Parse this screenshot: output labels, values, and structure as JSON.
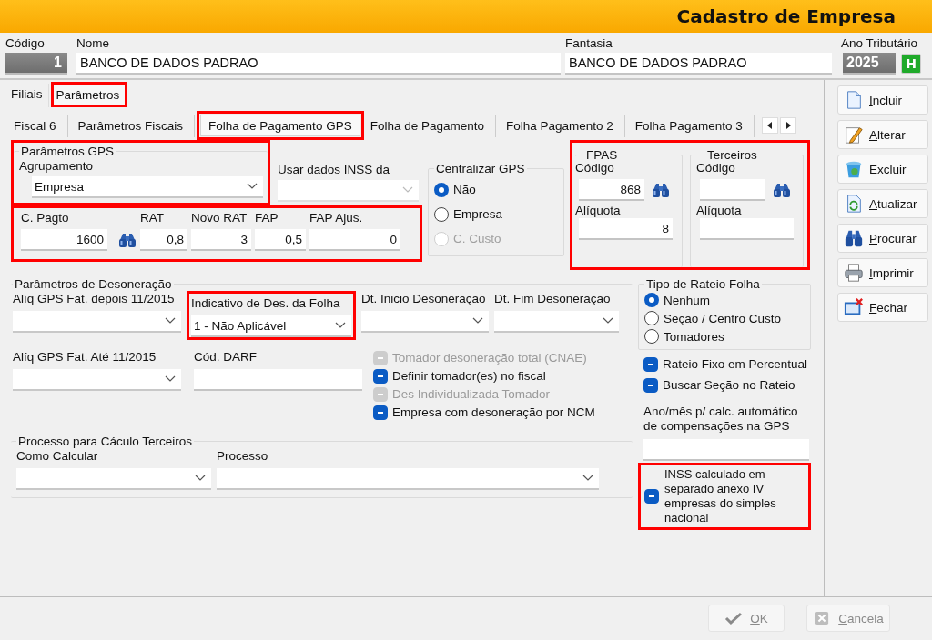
{
  "window": {
    "title": "Cadastro de Empresa"
  },
  "header": {
    "codigo": {
      "label": "Código",
      "value": "1"
    },
    "nome": {
      "label": "Nome",
      "value": "BANCO DE DADOS PADRAO"
    },
    "fantasia": {
      "label": "Fantasia",
      "value": "BANCO DE DADOS PADRAO"
    },
    "ano": {
      "label": "Ano Tributário",
      "value": "2025",
      "button": "H"
    }
  },
  "outer_tabs": [
    {
      "label": "Filiais",
      "selected": false,
      "highlighted": false
    },
    {
      "label": "Parâmetros",
      "selected": true,
      "highlighted": true
    }
  ],
  "inner_tabs": [
    {
      "label": "Fiscal 6",
      "selected": false,
      "highlighted": false
    },
    {
      "label": "Parâmetros Fiscais",
      "selected": false,
      "highlighted": false
    },
    {
      "label": "Folha de Pagamento GPS",
      "selected": true,
      "highlighted": true
    },
    {
      "label": "Folha de Pagamento",
      "selected": false,
      "highlighted": false
    },
    {
      "label": "Folha Pagamento 2",
      "selected": false,
      "highlighted": false
    },
    {
      "label": "Folha Pagamento 3",
      "selected": false,
      "highlighted": false
    }
  ],
  "parametros_gps": {
    "highlighted": true,
    "title": "Parâmetros GPS",
    "label": "Agrupamento",
    "value": "Empresa"
  },
  "usar_dados_inss": {
    "label": "Usar dados INSS da"
  },
  "pagamento": {
    "highlighted": true,
    "fields": [
      {
        "label": "C. Pagto",
        "value": "1600",
        "lookup": true
      },
      {
        "label": "RAT",
        "value": "0,8",
        "lookup": false
      },
      {
        "label": "Novo RAT",
        "value": "3",
        "lookup": false
      },
      {
        "label": "FAP",
        "value": "0,5",
        "lookup": false
      },
      {
        "label": "FAP Ajus.",
        "value": "0",
        "lookup": false
      }
    ]
  },
  "centralizar_gps": {
    "title": "Centralizar GPS",
    "options": [
      {
        "label": "Não",
        "selected": true,
        "disabled": false
      },
      {
        "label": "Empresa",
        "selected": false,
        "disabled": false
      },
      {
        "label": "C. Custo",
        "selected": false,
        "disabled": true
      }
    ]
  },
  "encargos": {
    "highlighted": true,
    "groups": [
      {
        "title": "FPAS",
        "code_label": "Código",
        "code": "868",
        "rate_label": "Alíquota",
        "rate": "8"
      },
      {
        "title": "Terceiros",
        "code_label": "Código",
        "rate_label": "Alíquota"
      }
    ]
  },
  "desoneracao": {
    "title": "Parâmetros de Desoneração",
    "aliq_depois": {
      "label": "Alíq GPS Fat. depois 11/2015"
    },
    "indicativo": {
      "label": "Indicativo de Des. da Folha",
      "value": "1 - Não Aplicável",
      "highlighted": true
    },
    "dt_inicio": {
      "label": "Dt. Inicio Desoneração"
    },
    "dt_fim": {
      "label": "Dt. Fim Desoneração"
    },
    "aliq_ate": {
      "label": "Alíq GPS Fat. Até 11/2015"
    },
    "cod_darf": {
      "label": "Cód. DARF"
    },
    "checks": [
      {
        "label": "Tomador desoneração total (CNAE)",
        "checked": true,
        "disabled": true
      },
      {
        "label": "Definir tomador(es) no fiscal",
        "checked": true,
        "disabled": false
      },
      {
        "label": "Des Individualizada Tomador",
        "checked": true,
        "disabled": true
      },
      {
        "label": "Empresa com desoneração por NCM",
        "checked": true,
        "disabled": false
      }
    ]
  },
  "processo": {
    "title": "Processo para Cáculo Terceiros",
    "como_label": "Como Calcular",
    "processo_label": "Processo"
  },
  "rateio": {
    "title": "Tipo de Rateio Folha",
    "options": [
      {
        "label": "Nenhum",
        "selected": true
      },
      {
        "label": "Seção / Centro Custo",
        "selected": false
      },
      {
        "label": "Tomadores",
        "selected": false
      }
    ]
  },
  "rateio_checks": [
    {
      "label": "Rateio Fixo em Percentual",
      "checked": true
    },
    {
      "label": "Buscar Seção no Rateio",
      "checked": true
    }
  ],
  "compensacao": {
    "label": "Ano/mês p/ calc. automático de compensações na GPS"
  },
  "inss_anexo": {
    "label": "INSS calculado em separado anexo IV empresas do simples nacional",
    "checked": true,
    "highlighted": true
  },
  "actions": [
    {
      "label": "Incluir",
      "kind": "new"
    },
    {
      "label": "Alterar",
      "kind": "edit"
    },
    {
      "label": "Excluir",
      "kind": "delete"
    },
    {
      "label": "Atualizar",
      "kind": "refresh"
    },
    {
      "label": "Procurar",
      "kind": "search"
    },
    {
      "label": "Imprimir",
      "kind": "print"
    },
    {
      "label": "Fechar",
      "kind": "close"
    }
  ],
  "footer": [
    {
      "label": "OK",
      "kind": "ok",
      "disabled": true
    },
    {
      "label": "Cancela",
      "kind": "cancel",
      "disabled": true
    }
  ]
}
